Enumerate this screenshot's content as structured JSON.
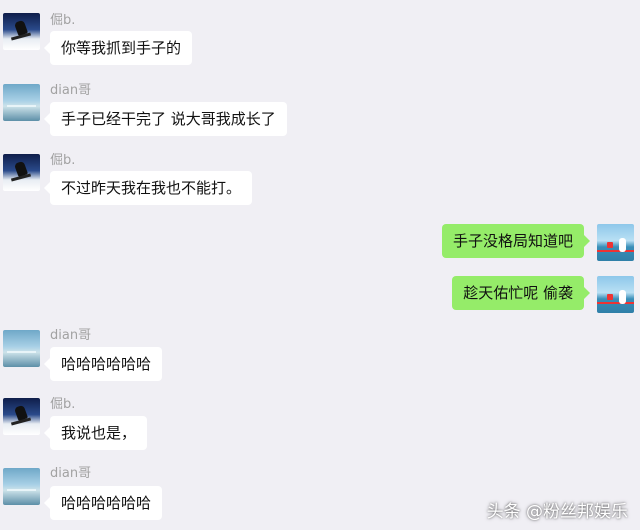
{
  "messages": [
    {
      "side": "left",
      "sender": "倔b.",
      "text": "你等我抓到手子的",
      "avatar": "skier-avatar"
    },
    {
      "side": "left",
      "sender": "dian哥",
      "text": "手子已经干完了 说大哥我成长了",
      "avatar": "landscape-avatar"
    },
    {
      "side": "left",
      "sender": "倔b.",
      "text": "不过昨天我在我也不能打。",
      "avatar": "skier-avatar"
    },
    {
      "side": "right",
      "sender": "",
      "text": "手子没格局知道吧",
      "avatar": "seaside-avatar"
    },
    {
      "side": "right",
      "sender": "",
      "text": "趁天佑忙呢 偷袭",
      "avatar": "seaside-avatar"
    },
    {
      "side": "left",
      "sender": "dian哥",
      "text": "哈哈哈哈哈哈",
      "avatar": "landscape-avatar"
    },
    {
      "side": "left",
      "sender": "倔b.",
      "text": "我说也是，",
      "avatar": "skier-avatar"
    },
    {
      "side": "left",
      "sender": "dian哥",
      "text": "哈哈哈哈哈哈",
      "avatar": "landscape-avatar"
    }
  ],
  "watermark": "头条 @粉丝邦娱乐",
  "colors": {
    "background": "#f0eff4",
    "left_bubble": "#ffffff",
    "right_bubble": "#95ec69",
    "name": "#a2a2a2"
  }
}
